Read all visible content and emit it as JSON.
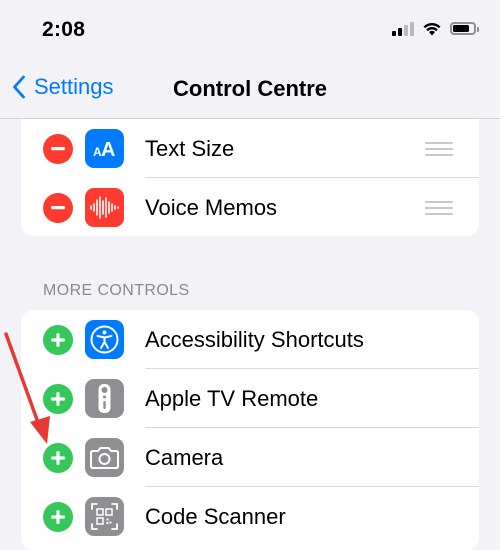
{
  "status_bar": {
    "time": "2:08"
  },
  "nav": {
    "back_label": "Settings",
    "title": "Control Centre"
  },
  "included_controls": [
    {
      "label": "Text Size",
      "icon": "text-size-icon",
      "icon_color": "#007aff"
    },
    {
      "label": "Voice Memos",
      "icon": "voice-memos-icon",
      "icon_color": "#ff3b30"
    }
  ],
  "more_controls": {
    "header": "MORE CONTROLS",
    "items": [
      {
        "label": "Accessibility Shortcuts",
        "icon": "accessibility-icon",
        "icon_color": "#007aff"
      },
      {
        "label": "Apple TV Remote",
        "icon": "apple-tv-remote-icon",
        "icon_color": "#8e8e93"
      },
      {
        "label": "Camera",
        "icon": "camera-icon",
        "icon_color": "#8e8e93"
      },
      {
        "label": "Code Scanner",
        "icon": "code-scanner-icon",
        "icon_color": "#8e8e93"
      }
    ]
  },
  "colors": {
    "accent": "#007aff",
    "remove": "#ff3b30",
    "add": "#34c759",
    "annotation": "#e53935"
  }
}
